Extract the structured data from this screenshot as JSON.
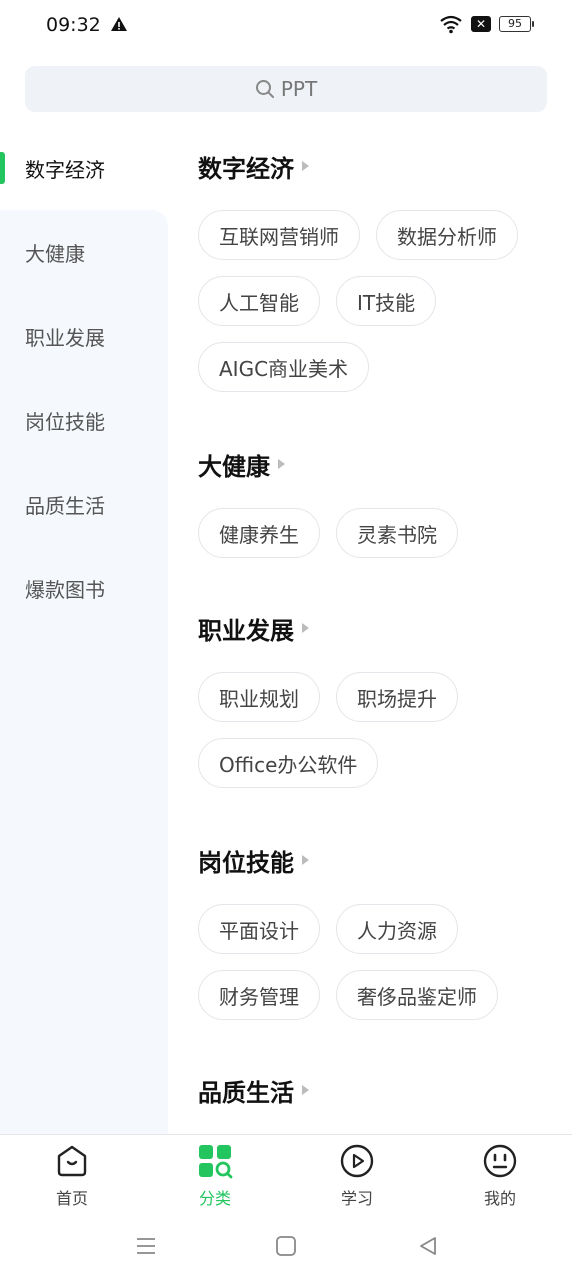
{
  "status": {
    "time": "09:32",
    "battery": "95"
  },
  "search": {
    "placeholder": "PPT"
  },
  "sidebar": {
    "items": [
      {
        "label": "数字经济",
        "active": true
      },
      {
        "label": "大健康"
      },
      {
        "label": "职业发展"
      },
      {
        "label": "岗位技能"
      },
      {
        "label": "品质生活"
      },
      {
        "label": "爆款图书"
      }
    ]
  },
  "sections": [
    {
      "title": "数字经济",
      "tags": [
        "互联网营销师",
        "数据分析师",
        "人工智能",
        "IT技能",
        "AIGC商业美术"
      ]
    },
    {
      "title": "大健康",
      "tags": [
        "健康养生",
        "灵素书院"
      ]
    },
    {
      "title": "职业发展",
      "tags": [
        "职业规划",
        "职场提升",
        "Office办公软件"
      ]
    },
    {
      "title": "岗位技能",
      "tags": [
        "平面设计",
        "人力资源",
        "财务管理",
        "奢侈品鉴定师"
      ]
    },
    {
      "title": "品质生活",
      "tags": []
    }
  ],
  "nav": {
    "home": "首页",
    "category": "分类",
    "study": "学习",
    "mine": "我的",
    "accent": "#22c55e"
  }
}
